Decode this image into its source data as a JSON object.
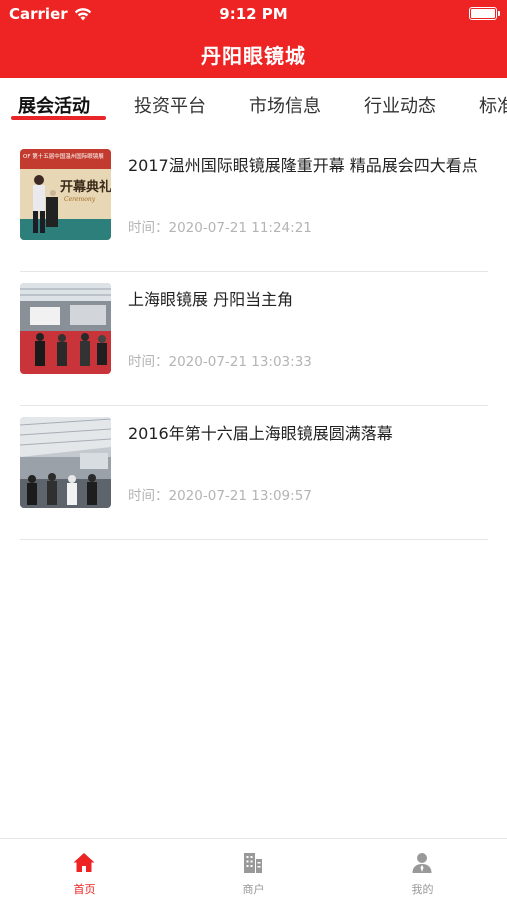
{
  "status_bar": {
    "carrier": "Carrier",
    "time": "9:12 PM",
    "wifi_icon": "wifi-icon",
    "battery_icon": "battery-icon"
  },
  "header": {
    "title": "丹阳眼镜城",
    "background_color": "#ee2424"
  },
  "tabs": [
    {
      "label": "展会活动",
      "active": true
    },
    {
      "label": "投资平台",
      "active": false
    },
    {
      "label": "市场信息",
      "active": false
    },
    {
      "label": "行业动态",
      "active": false
    },
    {
      "label": "标准",
      "active": false
    }
  ],
  "news": [
    {
      "title": "2017温州国际眼镜展隆重开幕 精品展会四大看点",
      "time": "时间：2020-07-21 11:24:21",
      "thumb_text": "开幕典礼",
      "thumb_subtext": "Ceremony",
      "thumb_banner": "OF 第十五届中国温州国际眼镜展"
    },
    {
      "title": "上海眼镜展 丹阳当主角",
      "time": "时间：2020-07-21 13:03:33"
    },
    {
      "title": "2016年第十六届上海眼镜展圆满落幕",
      "time": "时间：2020-07-21 13:09:57"
    }
  ],
  "bottom_nav": [
    {
      "label": "首页",
      "icon": "home-icon",
      "active": true
    },
    {
      "label": "商户",
      "icon": "building-icon",
      "active": false
    },
    {
      "label": "我的",
      "icon": "user-icon",
      "active": false
    }
  ],
  "colors": {
    "accent": "#ee2424",
    "inactive": "#999999",
    "time_text": "#b4b4b4"
  }
}
